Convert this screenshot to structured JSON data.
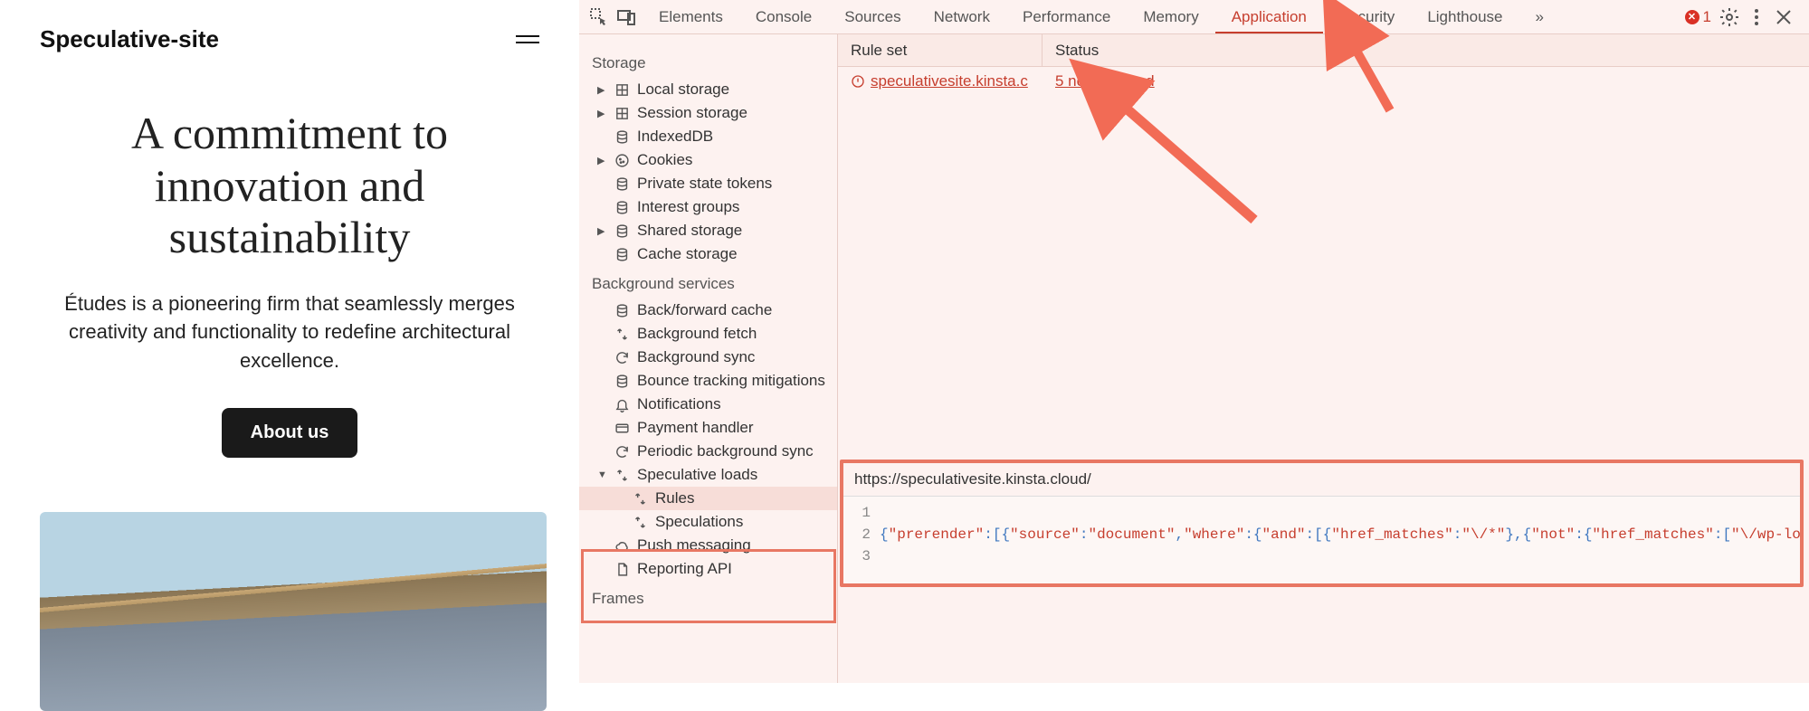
{
  "site": {
    "title": "Speculative-site",
    "heading": "A commitment to innovation and sustainability",
    "paragraph": "Études is a pioneering firm that seamlessly merges creativity and functionality to redefine architectural excellence.",
    "button": "About us"
  },
  "devtools": {
    "tabs": [
      "Elements",
      "Console",
      "Sources",
      "Network",
      "Performance",
      "Memory",
      "Application",
      "Security",
      "Lighthouse"
    ],
    "active_tab": "Application",
    "more_tabs_glyph": "»",
    "error_count": "1",
    "sidebar": {
      "section_storage": "Storage",
      "storage_items": [
        {
          "label": "Local storage",
          "icon": "grid",
          "expand": "▶"
        },
        {
          "label": "Session storage",
          "icon": "grid",
          "expand": "▶"
        },
        {
          "label": "IndexedDB",
          "icon": "db",
          "expand": ""
        },
        {
          "label": "Cookies",
          "icon": "cookie",
          "expand": "▶"
        },
        {
          "label": "Private state tokens",
          "icon": "db",
          "expand": ""
        },
        {
          "label": "Interest groups",
          "icon": "db",
          "expand": ""
        },
        {
          "label": "Shared storage",
          "icon": "db",
          "expand": "▶"
        },
        {
          "label": "Cache storage",
          "icon": "db",
          "expand": ""
        }
      ],
      "section_bg": "Background services",
      "bg_items": [
        {
          "label": "Back/forward cache",
          "icon": "db"
        },
        {
          "label": "Background fetch",
          "icon": "updown"
        },
        {
          "label": "Background sync",
          "icon": "sync"
        },
        {
          "label": "Bounce tracking mitigations",
          "icon": "db"
        },
        {
          "label": "Notifications",
          "icon": "bell"
        },
        {
          "label": "Payment handler",
          "icon": "card"
        },
        {
          "label": "Periodic background sync",
          "icon": "sync"
        },
        {
          "label": "Speculative loads",
          "icon": "updown",
          "expand": "▼",
          "children": [
            {
              "label": "Rules",
              "icon": "updown",
              "sel": true
            },
            {
              "label": "Speculations",
              "icon": "updown"
            }
          ]
        },
        {
          "label": "Push messaging",
          "icon": "cloud"
        },
        {
          "label": "Reporting API",
          "icon": "doc"
        }
      ],
      "section_frames": "Frames"
    },
    "table": {
      "col_rule": "Rule set",
      "col_status": "Status",
      "row_rule": "speculativesite.kinsta.c",
      "row_status": "5 not triggered"
    },
    "detail": {
      "url": "https://speculativesite.kinsta.cloud/",
      "line_nums": [
        "1",
        "2",
        "3"
      ],
      "json_tokens": [
        {
          "t": "{",
          "c": "p"
        },
        {
          "t": "\"prerender\"",
          "c": "k"
        },
        {
          "t": ":[{",
          "c": "p"
        },
        {
          "t": "\"source\"",
          "c": "k"
        },
        {
          "t": ":",
          "c": "p"
        },
        {
          "t": "\"document\"",
          "c": "s"
        },
        {
          "t": ",",
          "c": "p"
        },
        {
          "t": "\"where\"",
          "c": "k"
        },
        {
          "t": ":{",
          "c": "p"
        },
        {
          "t": "\"and\"",
          "c": "k"
        },
        {
          "t": ":[{",
          "c": "p"
        },
        {
          "t": "\"href_matches\"",
          "c": "k"
        },
        {
          "t": ":",
          "c": "p"
        },
        {
          "t": "\"\\/*\"",
          "c": "s"
        },
        {
          "t": "},{",
          "c": "p"
        },
        {
          "t": "\"not\"",
          "c": "k"
        },
        {
          "t": ":{",
          "c": "p"
        },
        {
          "t": "\"href_matches\"",
          "c": "k"
        },
        {
          "t": ":[",
          "c": "p"
        },
        {
          "t": "\"\\/wp-login.",
          "c": "s"
        }
      ]
    }
  }
}
